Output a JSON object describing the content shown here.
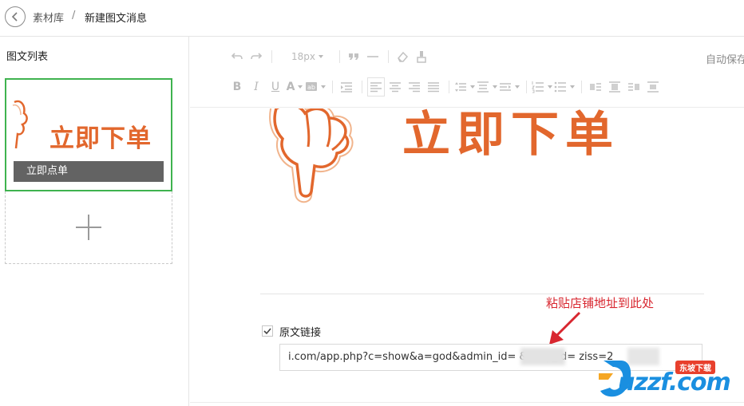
{
  "breadcrumb": {
    "library": "素材库",
    "separator": "/",
    "current": "新建图文消息"
  },
  "left_panel": {
    "title": "图文列表",
    "article": {
      "cover_text": "立即下单",
      "title": "立即点单"
    }
  },
  "toolbar": {
    "font_size": "18px",
    "autosave": "自动保存"
  },
  "content": {
    "banner_text": "立即下单"
  },
  "original_link": {
    "label": "原文链接",
    "checked": true,
    "url": "i.com/app.php?c=show&a=god&admin_id=          &shop_id=          ziss=2"
  },
  "annotation": {
    "text": "粘贴店铺地址到此处",
    "color": "#d8262f"
  },
  "watermark": {
    "text": "uzzf.com",
    "badge": "东坡下载"
  },
  "colors": {
    "accent_green": "#3fb34f",
    "banner_orange": "#e2672d",
    "annotation_red": "#d8262f"
  }
}
